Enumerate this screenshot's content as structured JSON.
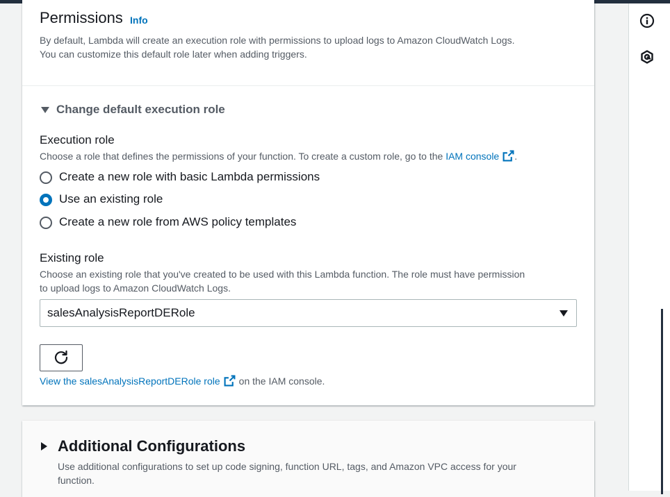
{
  "permissions": {
    "title": "Permissions",
    "info_link": "Info",
    "description_line1": "By default, Lambda will create an execution role with permissions to upload logs to Amazon CloudWatch Logs.",
    "description_line2": "You can customize this default role later when adding triggers."
  },
  "expander": {
    "label": "Change default execution role",
    "state": "expanded"
  },
  "execution_role": {
    "label": "Execution role",
    "description_prefix": "Choose a role that defines the permissions of your function. To create a custom role, go to the",
    "iam_console_link": "IAM console",
    "description_suffix": ".",
    "options": [
      {
        "label": "Create a new role with basic Lambda permissions",
        "selected": false
      },
      {
        "label": "Use an existing role",
        "selected": true
      },
      {
        "label": "Create a new role from AWS policy templates",
        "selected": false
      }
    ]
  },
  "existing_role": {
    "label": "Existing role",
    "description_line1": "Choose an existing role that you've created to be used with this Lambda function. The role must have permission",
    "description_line2": "to upload logs to Amazon CloudWatch Logs.",
    "selected_value": "salesAnalysisReportDERole",
    "view_link": "View the salesAnalysisReportDERole role",
    "view_suffix": "on the IAM console."
  },
  "additional_configurations": {
    "title": "Additional Configurations",
    "description_line1": "Use additional configurations to set up code signing, function URL, tags, and Amazon VPC access for your",
    "description_line2": "function."
  },
  "right_rail": {
    "icons": [
      "info-circle-icon",
      "settings-hexagon-icon"
    ]
  },
  "colors": {
    "link": "#0073bb",
    "header_bar": "#232f3e",
    "text": "#16191f",
    "secondary_text": "#545b64",
    "background": "#f2f3f3"
  }
}
